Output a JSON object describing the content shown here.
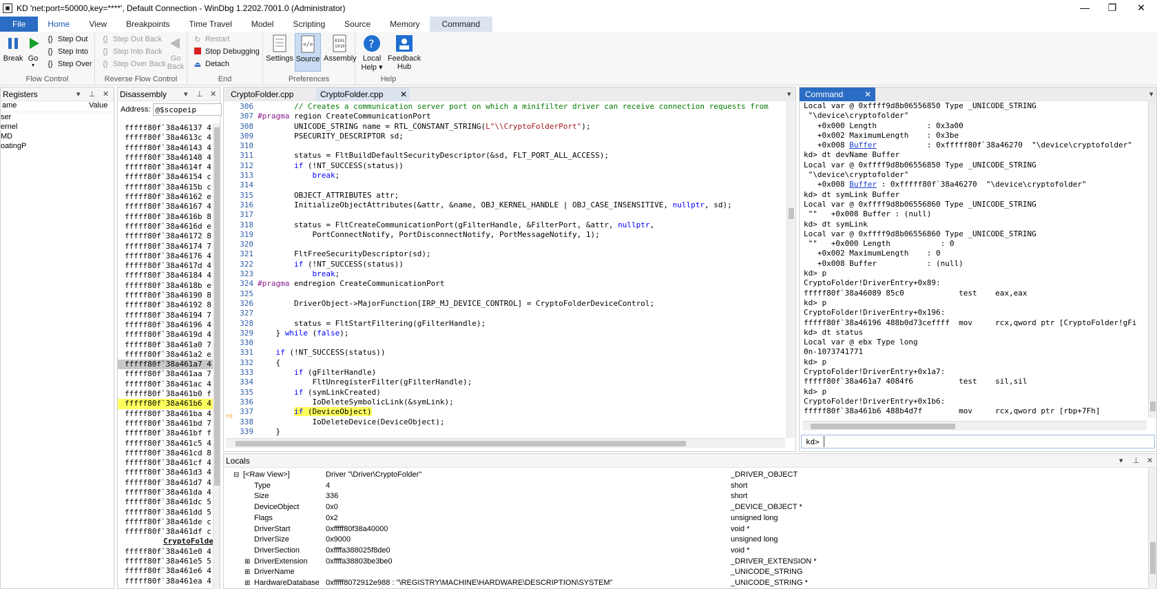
{
  "window": {
    "title": "KD 'net:port=50000,key=****', Default Connection  - WinDbg 1.2202.7001.0 (Administrator)",
    "minimize": "—",
    "restore": "❐",
    "close": "✕"
  },
  "ribbon_tabs": [
    "File",
    "Home",
    "View",
    "Breakpoints",
    "Time Travel",
    "Model",
    "Scripting",
    "Source",
    "Memory",
    "Command"
  ],
  "ribbon": {
    "flow_control": {
      "label": "Flow Control",
      "break": "Break",
      "go": "Go",
      "step_out": "Step Out",
      "step_into": "Step Into",
      "step_over": "Step Over"
    },
    "reverse_flow_control": {
      "label": "Reverse Flow Control",
      "step_out_back": "Step Out Back",
      "step_into_back": "Step Into Back",
      "step_over_back": "Step Over Back",
      "go_back_1": "Go",
      "go_back_2": "Back"
    },
    "end": {
      "label": "End",
      "restart": "Restart",
      "stop_debugging": "Stop Debugging",
      "detach": "Detach"
    },
    "preferences": {
      "label": "Preferences",
      "settings": "Settings",
      "source": "Source",
      "assembly": "Assembly"
    },
    "help": {
      "label": "Help",
      "local_help_1": "Local",
      "local_help_2": "Help ▾",
      "feedback_hub_1": "Feedback",
      "feedback_hub_2": "Hub"
    }
  },
  "registers": {
    "title": "Registers",
    "col_name": "ame",
    "col_value": "Value",
    "items": [
      "ser",
      "ernel",
      "MD",
      "oatingP"
    ]
  },
  "disassembly": {
    "title": "Disassembly",
    "address_label": "Address:",
    "address_value": "@$scopeip",
    "lines": [
      "fffff80f`38a46137 4",
      "fffff80f`38a4613c 4",
      "fffff80f`38a46143 4",
      "fffff80f`38a46148 4",
      "fffff80f`38a4614f 4",
      "fffff80f`38a46154 c",
      "fffff80f`38a4615b c",
      "fffff80f`38a46162 e",
      "fffff80f`38a46167 4",
      "fffff80f`38a4616b 8",
      "fffff80f`38a4616d e",
      "fffff80f`38a46172 8",
      "fffff80f`38a46174 7",
      "fffff80f`38a46176 4",
      "fffff80f`38a4617d 4",
      "fffff80f`38a46184 4",
      "fffff80f`38a4618b e",
      "fffff80f`38a46190 8",
      "fffff80f`38a46192 8",
      "fffff80f`38a46194 7",
      "fffff80f`38a46196 4",
      "fffff80f`38a4619d 4",
      "fffff80f`38a461a0 7",
      "fffff80f`38a461a2 e",
      "fffff80f`38a461a7 4",
      "fffff80f`38a461aa 7",
      "fffff80f`38a461ac 4",
      "fffff80f`38a461b0 f",
      "fffff80f`38a461b6 4",
      "fffff80f`38a461ba 4",
      "fffff80f`38a461bd 7",
      "fffff80f`38a461bf f",
      "fffff80f`38a461c5 4",
      "fffff80f`38a461cd 8",
      "fffff80f`38a461cf 4",
      "fffff80f`38a461d3 4",
      "fffff80f`38a461d7 4",
      "fffff80f`38a461da 4",
      "fffff80f`38a461dc 5",
      "fffff80f`38a461dd 5",
      "fffff80f`38a461de c",
      "fffff80f`38a461df c",
      "CryptoFolder!Gs",
      "fffff80f`38a461e0 4",
      "fffff80f`38a461e5 5",
      "fffff80f`38a461e6 4",
      "fffff80f`38a461ea 4"
    ]
  },
  "source": {
    "tabs": [
      "CryptoFolder.cpp",
      "CryptoFolder.cpp"
    ],
    "lines": [
      {
        "n": "306",
        "html": "        <span class='cm'>// Creates a communication server port on which a minifilter driver can receive connection requests from</span>"
      },
      {
        "n": "307",
        "html": "<span class='pp'>#pragma</span> region CreateCommunicationPort"
      },
      {
        "n": "308",
        "html": "        UNICODE_STRING name = RTL_CONSTANT_STRING(<span class='st'>L\"\\\\CryptoFolderPort\"</span>);"
      },
      {
        "n": "309",
        "html": "        PSECURITY_DESCRIPTOR sd;"
      },
      {
        "n": "310",
        "html": ""
      },
      {
        "n": "311",
        "html": "        status = FltBuildDefaultSecurityDescriptor(&amp;sd, FLT_PORT_ALL_ACCESS);"
      },
      {
        "n": "312",
        "html": "        <span class='kw'>if</span> (!NT_SUCCESS(status))"
      },
      {
        "n": "313",
        "html": "            <span class='kw'>break</span>;"
      },
      {
        "n": "314",
        "html": ""
      },
      {
        "n": "315",
        "html": "        OBJECT_ATTRIBUTES attr;"
      },
      {
        "n": "316",
        "html": "        InitializeObjectAttributes(&amp;attr, &amp;name, OBJ_KERNEL_HANDLE | OBJ_CASE_INSENSITIVE, <span class='kw'>nullptr</span>, sd);"
      },
      {
        "n": "317",
        "html": ""
      },
      {
        "n": "318",
        "html": "        status = FltCreateCommunicationPort(gFilterHandle, &amp;FilterPort, &amp;attr, <span class='kw'>nullptr</span>,"
      },
      {
        "n": "319",
        "html": "            PortConnectNotify, PortDisconnectNotify, PortMessageNotify, 1);"
      },
      {
        "n": "320",
        "html": ""
      },
      {
        "n": "321",
        "html": "        FltFreeSecurityDescriptor(sd);"
      },
      {
        "n": "322",
        "html": "        <span class='kw'>if</span> (!NT_SUCCESS(status))"
      },
      {
        "n": "323",
        "html": "            <span class='kw'>break</span>;"
      },
      {
        "n": "324",
        "html": "<span class='pp'>#pragma</span> endregion CreateCommunicationPort"
      },
      {
        "n": "325",
        "html": ""
      },
      {
        "n": "326",
        "html": "        DriverObject-&gt;MajorFunction[IRP_MJ_DEVICE_CONTROL] = CryptoFolderDeviceControl;"
      },
      {
        "n": "327",
        "html": ""
      },
      {
        "n": "328",
        "html": "        status = FltStartFiltering(gFilterHandle);"
      },
      {
        "n": "329",
        "html": "    } <span class='kw'>while</span> (<span class='kw'>false</span>);"
      },
      {
        "n": "330",
        "html": ""
      },
      {
        "n": "331",
        "html": "    <span class='kw'>if</span> (!NT_SUCCESS(status))"
      },
      {
        "n": "332",
        "html": "    {"
      },
      {
        "n": "333",
        "html": "        <span class='kw'>if</span> (gFilterHandle)"
      },
      {
        "n": "334",
        "html": "            FltUnregisterFilter(gFilterHandle);"
      },
      {
        "n": "335",
        "html": "        <span class='kw'>if</span> (symLinkCreated)"
      },
      {
        "n": "336",
        "html": "            IoDeleteSymbolicLink(&amp;symLink);"
      },
      {
        "n": "337",
        "html": "        <span class='hl-src'><span class='kw'>if</span> (DeviceObject)</span>"
      },
      {
        "n": "338",
        "html": "            IoDeleteDevice(DeviceObject);"
      },
      {
        "n": "339",
        "html": "    }"
      }
    ]
  },
  "command": {
    "title": "Command",
    "prompt": "kd>",
    "lines": [
      {
        "html": "Local var @ 0xffff9d8b06556850 Type _UNICODE_STRING"
      },
      {
        "html": " \"\\device\\cryptofolder\""
      },
      {
        "html": "   +0x000 Length           : 0x3a00"
      },
      {
        "html": "   +0x002 MaximumLength    : 0x3be"
      },
      {
        "html": "   +0x008 <span class='lnk'>Buffer</span>           : 0xfffff80f`38a46270  \"\\device\\cryptofolder\""
      },
      {
        "html": "kd&gt; dt devName Buffer"
      },
      {
        "html": "Local var @ 0xffff9d8b06556850 Type _UNICODE_STRING"
      },
      {
        "html": " \"\\device\\cryptofolder\""
      },
      {
        "html": "   +0x008 <span class='lnk'>Buffer</span> : 0xfffff80f`38a46270  \"\\device\\cryptofolder\""
      },
      {
        "html": "kd&gt; dt symLink Buffer"
      },
      {
        "html": "Local var @ 0xffff9d8b06556860 Type _UNICODE_STRING"
      },
      {
        "html": " \"\"   +0x008 Buffer : (null)"
      },
      {
        "html": "kd&gt; dt symLink"
      },
      {
        "html": "Local var @ 0xffff9d8b06556860 Type _UNICODE_STRING"
      },
      {
        "html": " \"\"   +0x000 Length           : 0"
      },
      {
        "html": "   +0x002 MaximumLength    : 0"
      },
      {
        "html": "   +0x008 Buffer           : (null)"
      },
      {
        "html": "kd&gt; p"
      },
      {
        "html": "CryptoFolder!DriverEntry+0x89:"
      },
      {
        "html": "fffff80f`38a46089 85c0            test    eax,eax"
      },
      {
        "html": "kd&gt; p"
      },
      {
        "html": "CryptoFolder!DriverEntry+0x196:"
      },
      {
        "html": "fffff80f`38a46196 488b0d73ceffff  mov     rcx,qword ptr [CryptoFolder!gFi"
      },
      {
        "html": "kd&gt; dt status"
      },
      {
        "html": "Local var @ ebx Type long"
      },
      {
        "html": "0n-1073741771"
      },
      {
        "html": "kd&gt; p"
      },
      {
        "html": "CryptoFolder!DriverEntry+0x1a7:"
      },
      {
        "html": "fffff80f`38a461a7 4084f6          test    sil,sil"
      },
      {
        "html": "kd&gt; p"
      },
      {
        "html": "CryptoFolder!DriverEntry+0x1b6:"
      },
      {
        "html": "fffff80f`38a461b6 488b4d7f        mov     rcx,qword ptr [rbp+7Fh]"
      }
    ]
  },
  "locals": {
    "title": "Locals",
    "rows": [
      {
        "name": "[<Raw View>]",
        "value": "Driver \"\\Driver\\CryptoFolder\"",
        "type": "_DRIVER_OBJECT",
        "indent": 1,
        "expander": "⊟"
      },
      {
        "name": "Type",
        "value": "4",
        "type": "short",
        "indent": 2,
        "expander": ""
      },
      {
        "name": "Size",
        "value": "336",
        "type": "short",
        "indent": 2,
        "expander": ""
      },
      {
        "name": "DeviceObject",
        "value": "0x0",
        "type": "_DEVICE_OBJECT *",
        "indent": 2,
        "expander": ""
      },
      {
        "name": "Flags",
        "value": "0x2",
        "type": "unsigned long",
        "indent": 2,
        "expander": ""
      },
      {
        "name": "DriverStart",
        "value": "0xfffff80f38a40000",
        "type": "void *",
        "indent": 2,
        "expander": ""
      },
      {
        "name": "DriverSize",
        "value": "0x9000",
        "type": "unsigned long",
        "indent": 2,
        "expander": ""
      },
      {
        "name": "DriverSection",
        "value": "0xffffa388025f8de0",
        "type": "void *",
        "indent": 2,
        "expander": ""
      },
      {
        "name": "DriverExtension",
        "value": "0xffffa38803be3be0",
        "type": "_DRIVER_EXTENSION *",
        "indent": 2,
        "expander": "⊞"
      },
      {
        "name": "DriverName",
        "value": "",
        "type": "_UNICODE_STRING",
        "indent": 2,
        "expander": "⊞"
      },
      {
        "name": "HardwareDatabase",
        "value": "0xfffff8072912e988 : \"\\REGISTRY\\MACHINE\\HARDWARE\\DESCRIPTION\\SYSTEM\"",
        "type": "_UNICODE_STRING *",
        "indent": 2,
        "expander": "⊞"
      }
    ]
  }
}
